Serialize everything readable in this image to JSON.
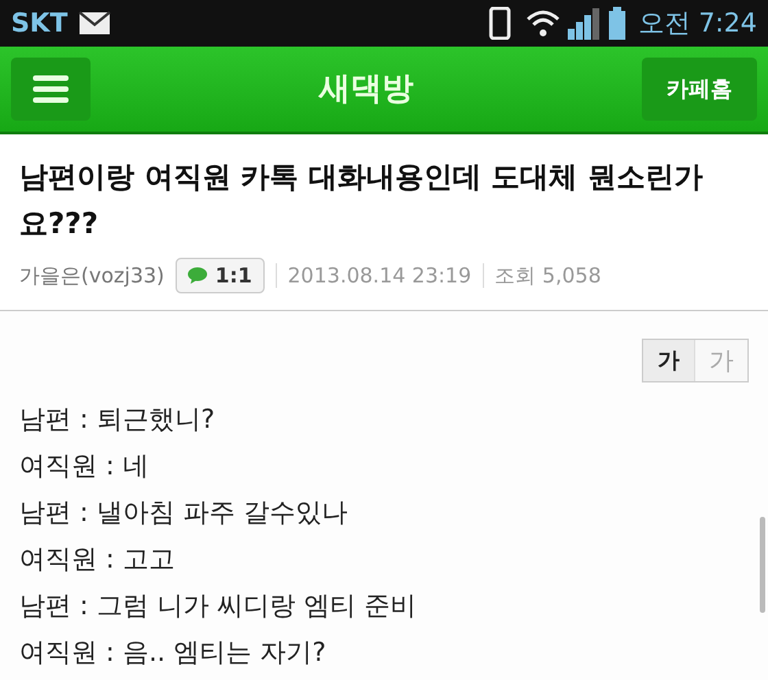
{
  "status_bar": {
    "carrier": "SKT",
    "time": "오전 7:24"
  },
  "header": {
    "title": "새댁방",
    "right_button": "카페홈"
  },
  "post": {
    "title": "남편이랑 여직원 카톡 대화내용인데 도대체 뭔소린가요???",
    "author": "가을은(vozj33)",
    "chat_button": "1:1",
    "date": "2013.08.14 23:19",
    "views": "조회 5,058"
  },
  "font_sizes": [
    {
      "label": "가",
      "selected": true
    },
    {
      "label": "가",
      "selected": false
    }
  ],
  "lines": [
    "남편 : 퇴근했니?",
    "여직원 : 네",
    "남편 : 낼아침 파주 갈수있나",
    "여직원 : 고고",
    "남편 : 그럼 니가 씨디랑 엠티 준비",
    "여직원 : 음.. 엠티는 자기?"
  ]
}
